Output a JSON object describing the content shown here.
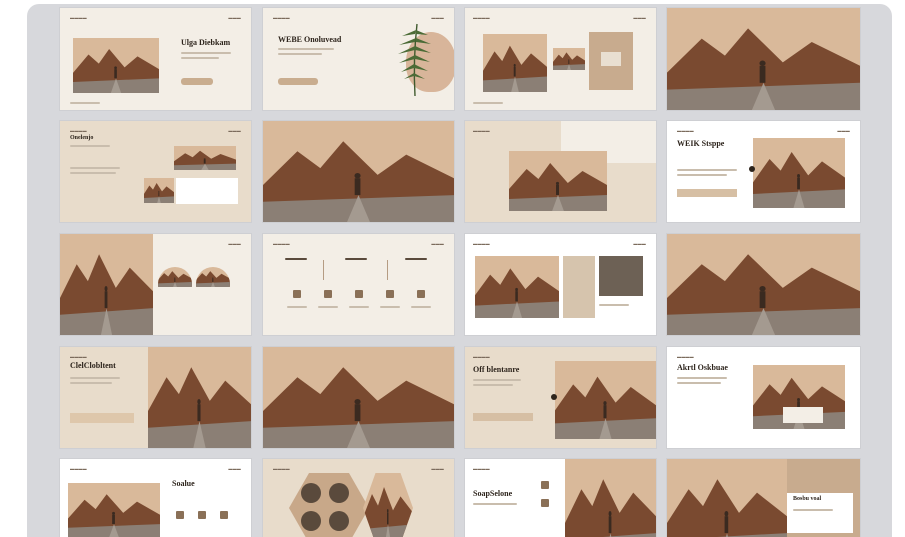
{
  "gallery": {
    "title_r1c1": "Ulga Diebkam",
    "title_r1c2": "WEBE Onoluvead",
    "title_r2c1": "Onelenjo",
    "title_r2c4": "WEIK Stsppe",
    "title_r4c1": "ClelClobltent",
    "title_r4c3": "Off blentanre",
    "title_r4c4": "Akrtl Oskbuae",
    "title_r5c1": "Soalue",
    "title_r5c3": "SoapSelone",
    "title_r5c4": "Bosbu voal",
    "colors": {
      "frame": "#d7d8dc",
      "slide_light": "#f3eee6",
      "slide_tan": "#e6d9c8",
      "accent": "#c9ad8f",
      "dark_text": "#2d241c",
      "sky": "#d9b99a",
      "rock": "#7a4a30",
      "road": "#8b7f75"
    },
    "icons": [
      "fern-leaf-icon",
      "arrow-icon",
      "circle-icon"
    ]
  }
}
